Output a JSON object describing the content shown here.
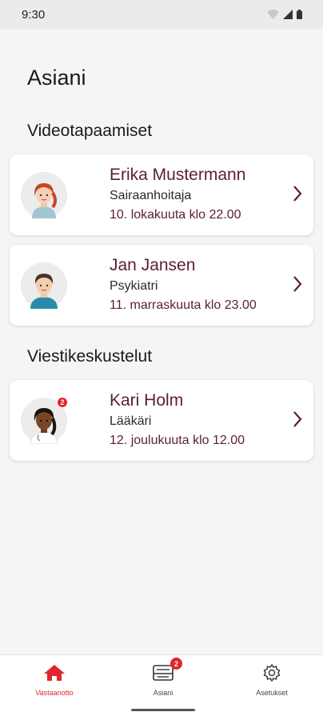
{
  "status_bar": {
    "time": "9:30",
    "icons": [
      "wifi-icon",
      "signal-icon",
      "battery-icon"
    ]
  },
  "page": {
    "title": "Asiani"
  },
  "sections": {
    "video": {
      "title": "Videotapaamiset",
      "items": [
        {
          "name": "Erika Mustermann",
          "role": "Sairaanhoitaja",
          "time": "10. lokakuuta klo 22.00"
        },
        {
          "name": "Jan Jansen",
          "role": "Psykiatri",
          "time": "11. marraskuuta klo 23.00"
        }
      ]
    },
    "messages": {
      "title": "Viestikeskustelut",
      "items": [
        {
          "name": "Kari Holm",
          "role": "Lääkäri",
          "time": "12. joulukuuta klo 12.00",
          "badge": "2"
        }
      ]
    }
  },
  "bottom_nav": {
    "items": [
      {
        "label": "Vastaanotto",
        "icon": "home-icon",
        "active": true
      },
      {
        "label": "Asiani",
        "icon": "inbox-icon",
        "badge": "2"
      },
      {
        "label": "Asetukset",
        "icon": "gear-icon"
      }
    ]
  },
  "colors": {
    "accent": "#e0262e",
    "name_text": "#5b1f2e"
  }
}
